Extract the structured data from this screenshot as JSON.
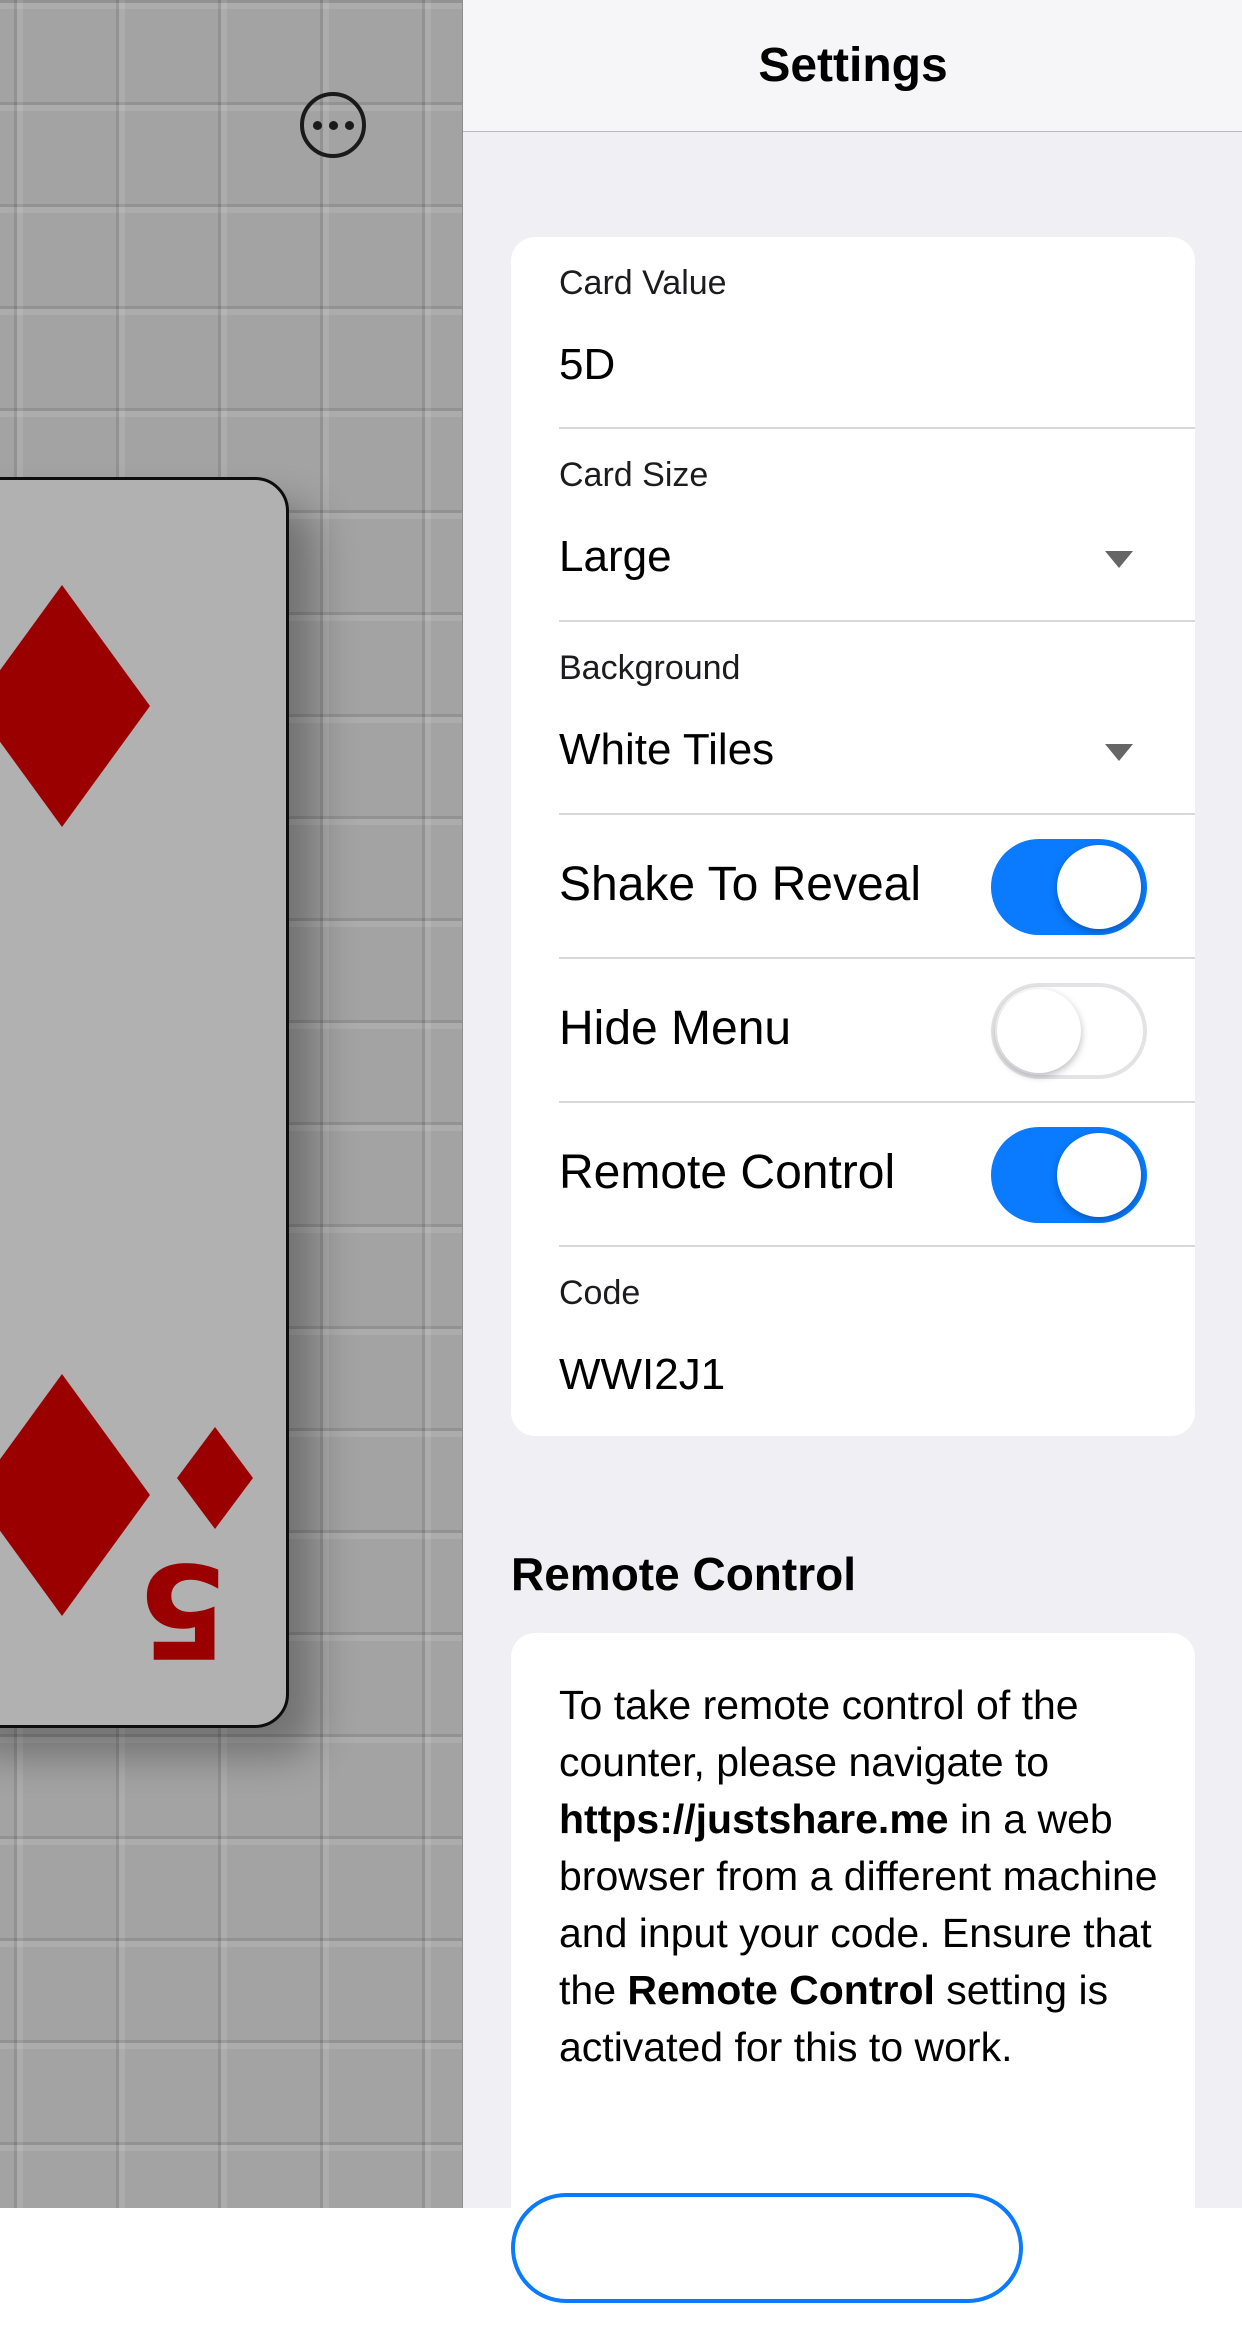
{
  "nav": {
    "title": "Settings"
  },
  "game": {
    "menu_icon": "more-horizontal-icon",
    "card": {
      "rank": "5",
      "suit": "diamonds",
      "suit_color": "#9b0000"
    }
  },
  "settings": {
    "card_value": {
      "label": "Card Value",
      "value": "5D"
    },
    "card_size": {
      "label": "Card Size",
      "value": "Large"
    },
    "background": {
      "label": "Background",
      "value": "White Tiles"
    },
    "shake_to_reveal": {
      "label": "Shake To Reveal",
      "on": true
    },
    "hide_menu": {
      "label": "Hide Menu",
      "on": false
    },
    "remote_control": {
      "label": "Remote Control",
      "on": true
    },
    "code": {
      "label": "Code",
      "value": "WWI2J1"
    }
  },
  "remote_section": {
    "title": "Remote Control",
    "text_1": "To take remote control of the counter, please navigate to ",
    "url": "https://justshare.me",
    "text_2": " in a web browser from a different machine and input your code. Ensure that the ",
    "setting_name": "Remote Control",
    "text_3": " setting is activated for this to work."
  },
  "colors": {
    "accent": "#0a7bff",
    "panel_bg": "#efeff4",
    "tile_bg": "#a3a3a3"
  }
}
